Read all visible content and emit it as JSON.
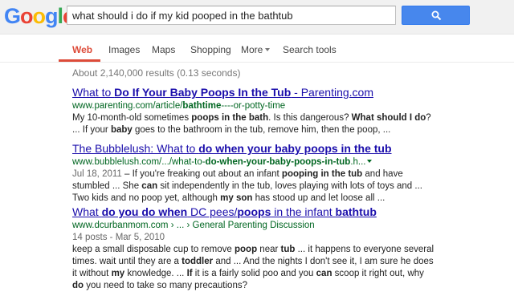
{
  "logo": {
    "letters": [
      "G",
      "o",
      "o",
      "g",
      "l",
      "e"
    ],
    "colors": [
      "#4285f4",
      "#ea4335",
      "#fbbc05",
      "#4285f4",
      "#34a853",
      "#ea4335"
    ]
  },
  "search": {
    "query": "what should i do if my kid pooped in the bathtub",
    "button_icon": "magnifier-icon"
  },
  "tabs": [
    {
      "label": "Web",
      "active": true
    },
    {
      "label": "Images"
    },
    {
      "label": "Maps"
    },
    {
      "label": "Shopping"
    },
    {
      "label": "More"
    },
    {
      "label": "Search tools"
    }
  ],
  "stats": "About 2,140,000 results (0.13 seconds)",
  "results": [
    {
      "title_parts": [
        "What to ",
        "Do If Your Baby Poops In the Tub",
        " - Parenting.com"
      ],
      "url_parts": [
        "www.parenting.com/article/",
        "bathtime",
        "----or-potty-time"
      ],
      "snippet": [
        [
          "My 10-month-old sometimes ",
          "poops in the bath",
          ". Is this dangerous? ",
          "What should I do",
          "?"
        ],
        [
          "... If your ",
          "baby",
          " goes to the bathroom in the tub, remove him, then the poop, ..."
        ]
      ]
    },
    {
      "title_parts": [
        "The Bubblelush: What to ",
        "do when your baby poops in the tub"
      ],
      "url_parts": [
        "www.bubblelush.com/.../what-to-",
        "do-when-your-baby-poops-in-tub",
        ".h..."
      ],
      "date": "Jul 18, 2011",
      "snippet": [
        [
          " – If you're freaking out about an infant ",
          "pooping in the tub",
          " and have"
        ],
        [
          "stumbled ... She ",
          "can",
          " sit independently in the tub, loves playing with lots of toys and ..."
        ],
        [
          "Two kids and no poop yet, although ",
          "my son",
          " has stood up and let loose all ..."
        ]
      ]
    },
    {
      "title_parts": [
        "What ",
        "do you do when",
        " DC pees/",
        "poops",
        " in the infant ",
        "bathtub"
      ],
      "url_parts": [
        "www.dcurbanmom.com › ... › ",
        "General Parenting Discussion"
      ],
      "meta": "14 posts - Mar 5, 2010",
      "snippet": [
        [
          "keep a small disposable cup to remove ",
          "poop",
          " near ",
          "tub",
          " ... it happens to everyone several"
        ],
        [
          "times. wait until they are a ",
          "toddler",
          " and ... And the nights I don't see it, I am sure he does"
        ],
        [
          "it without ",
          "my",
          " knowledge. ... ",
          "If",
          " it is a fairly solid poo and you ",
          "can",
          " scoop it right out, why"
        ],
        [
          "",
          "do",
          " you need to take so many precautions?"
        ]
      ]
    }
  ]
}
